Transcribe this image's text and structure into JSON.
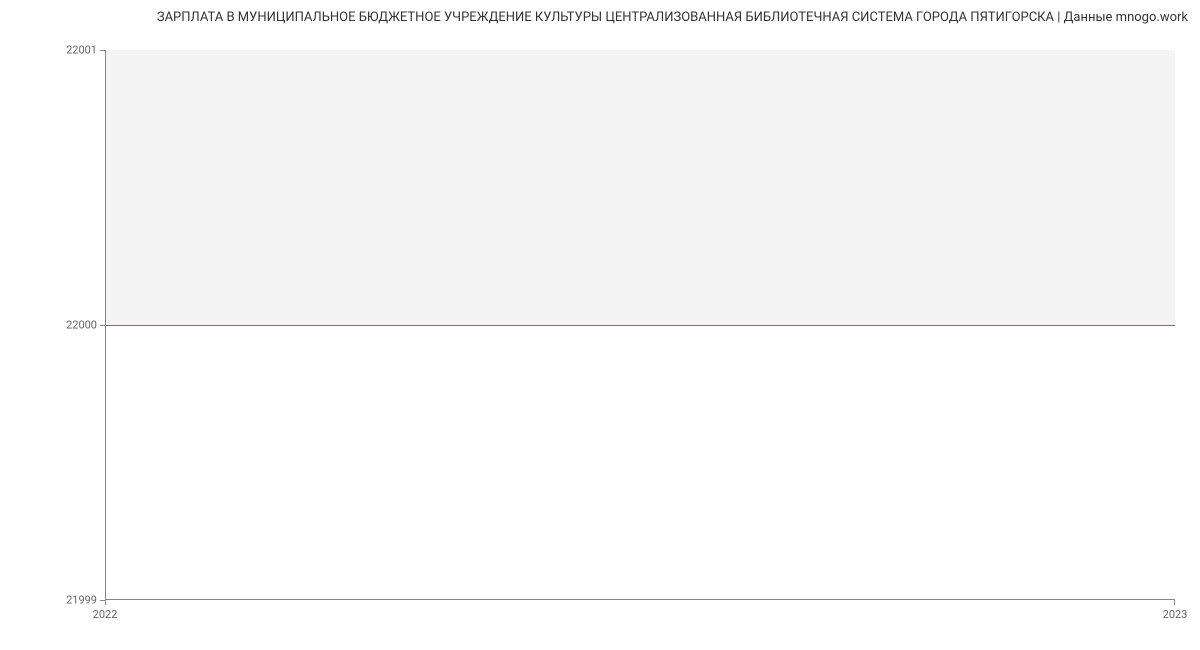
{
  "chart_data": {
    "type": "line",
    "title": "ЗАРПЛАТА В МУНИЦИПАЛЬНОЕ БЮДЖЕТНОЕ УЧРЕЖДЕНИЕ КУЛЬТУРЫ ЦЕНТРАЛИЗОВАННАЯ БИБЛИОТЕЧНАЯ СИСТЕМА ГОРОДА ПЯТИГОРСКА | Данные mnogo.work",
    "x": [
      "2022",
      "2023"
    ],
    "values": [
      22000,
      22000
    ],
    "xlabel": "",
    "ylabel": "",
    "xlim": [
      "2022",
      "2023"
    ],
    "ylim": [
      21999,
      22001
    ],
    "y_ticks": [
      "22001",
      "22000",
      "21999"
    ],
    "x_ticks": [
      "2022",
      "2023"
    ],
    "line_color": "#4a7ec8"
  }
}
